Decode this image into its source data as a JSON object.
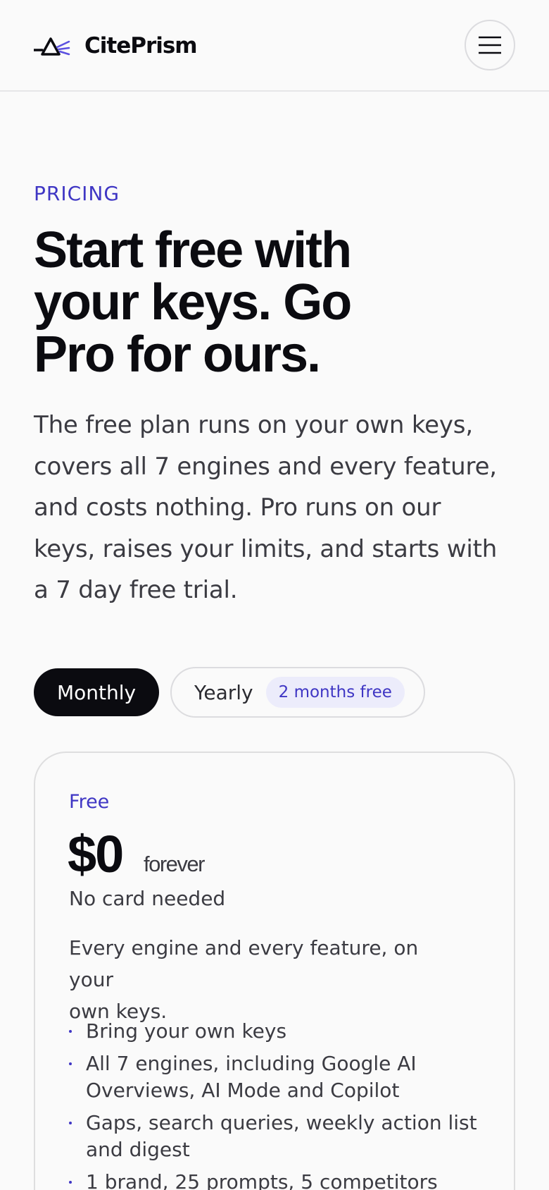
{
  "header": {
    "brand_name": "CitePrism",
    "logo_icon": "prism-logo-icon",
    "menu_icon": "hamburger-menu-icon"
  },
  "hero": {
    "eyebrow": "PRICING",
    "headline_lines": [
      "Start free with",
      "your keys. Go",
      "Pro for ours."
    ],
    "lede_lines": [
      "The free plan runs on your own keys,",
      "covers all 7 engines and every feature,",
      "and costs nothing. Pro runs on our",
      "keys, raises your limits, and starts with",
      "a 7 day free trial."
    ]
  },
  "billing_toggle": {
    "monthly_label": "Monthly",
    "yearly_label": "Yearly",
    "yearly_badge": "2 months free",
    "selected": "Monthly"
  },
  "plans": [
    {
      "name": "Free",
      "price": "$0",
      "period": "forever",
      "note": "No card needed",
      "description_lines": [
        "Every engine and every feature, on your",
        "own keys."
      ],
      "features": [
        [
          "Bring your own keys"
        ],
        [
          "All 7 engines, including Google AI",
          "Overviews, AI Mode and Copilot"
        ],
        [
          "Gaps, search queries, weekly action list",
          "and digest"
        ],
        [
          "1 brand, 25 prompts, 5 competitors"
        ]
      ]
    }
  ],
  "colors": {
    "accent": "#3f36c4",
    "text_primary": "#0b0b10",
    "text_secondary": "#3b3b42",
    "background": "#fafafa",
    "border": "#dcdcdf",
    "badge_bg": "#ececfb"
  }
}
